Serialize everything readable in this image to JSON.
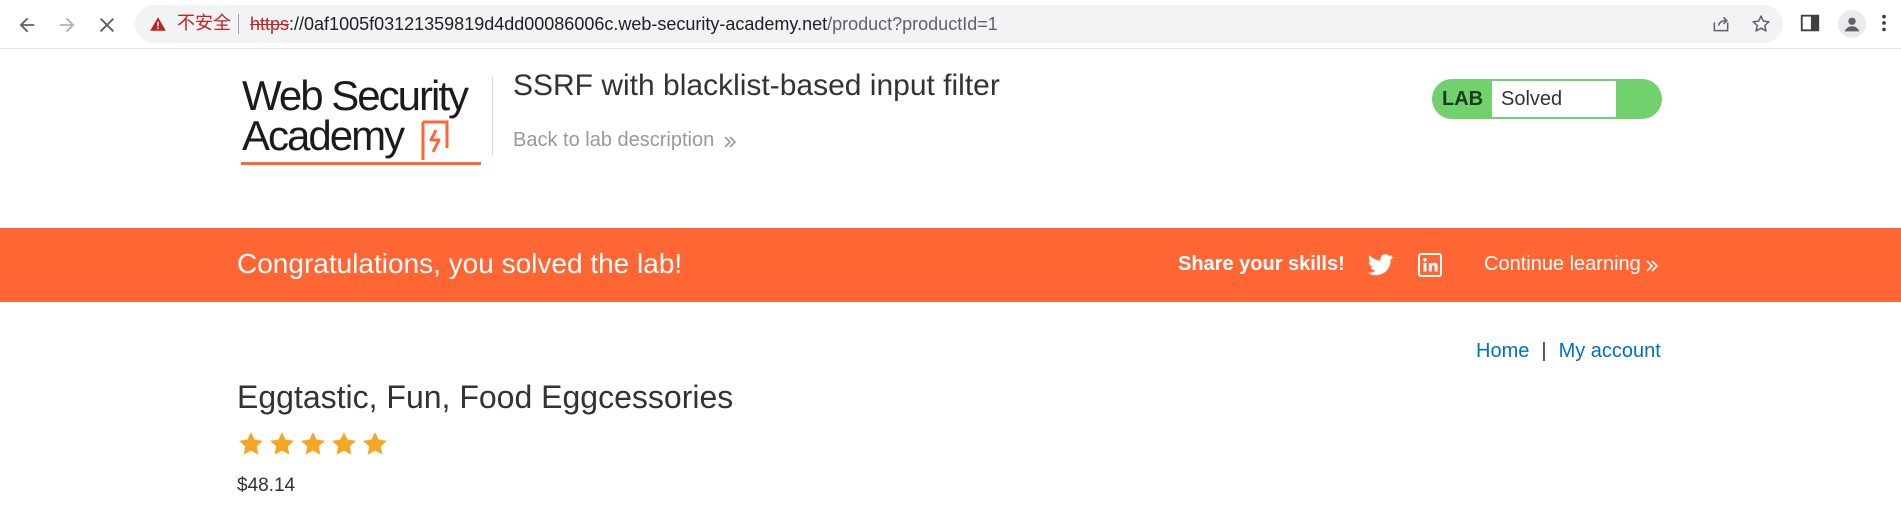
{
  "browser": {
    "insecure_label": "不安全",
    "url_scheme": "https",
    "url_host": "://0af1005f03121359819d4dd00086006c.web-security-academy.net",
    "url_path": "/product?productId=1"
  },
  "header": {
    "logo_line1": "Web Security",
    "logo_line2": "Academy",
    "lab_title": "SSRF with blacklist-based input filter",
    "back_link": "Back to lab description",
    "lab_label": "LAB",
    "lab_state": "Solved"
  },
  "banner": {
    "message": "Congratulations, you solved the lab!",
    "share_label": "Share your skills!",
    "continue_label": "Continue learning"
  },
  "nav": {
    "home": "Home",
    "separator": "|",
    "account": "My account"
  },
  "product": {
    "title": "Eggtastic, Fun, Food Eggcessories",
    "rating": 5,
    "rating_max": 5,
    "price": "$48.14"
  },
  "colors": {
    "brand_orange": "#ff6633",
    "solved_green": "#70d16d",
    "link_blue": "#0071bc",
    "star_gold": "#f5a623"
  }
}
